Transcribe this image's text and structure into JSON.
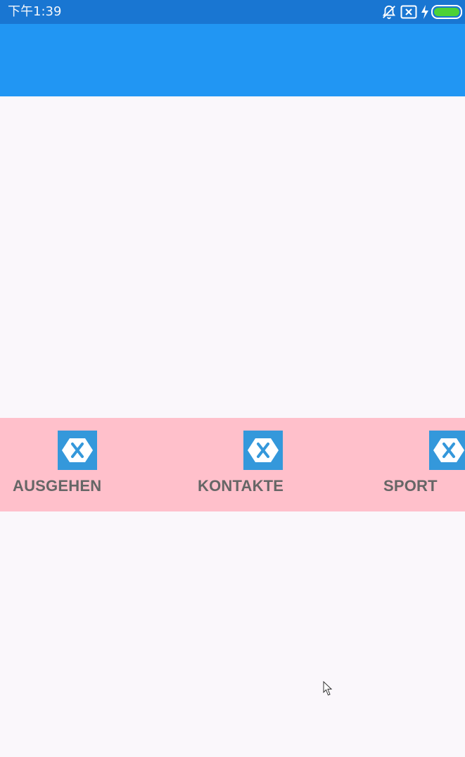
{
  "status_bar": {
    "time": "下午1:39",
    "icons": [
      "notifications-off-icon",
      "sim-card-error-icon",
      "charging-icon",
      "battery-icon"
    ],
    "battery_color": "#4cd137"
  },
  "toolbar": {
    "color": "#2196f3"
  },
  "tab_strip": {
    "background": "#ffc0cb",
    "tabs": [
      {
        "label": "AUSGEHEN",
        "icon": "xamarin-logo-icon"
      },
      {
        "label": "KONTAKTE",
        "icon": "xamarin-logo-icon"
      },
      {
        "label": "SPORT",
        "icon": "xamarin-logo-icon"
      }
    ]
  },
  "colors": {
    "status_bar": "#1976d2",
    "page_background": "#faf7fb",
    "icon_tile": "#3498db",
    "tab_label": "#666666"
  }
}
